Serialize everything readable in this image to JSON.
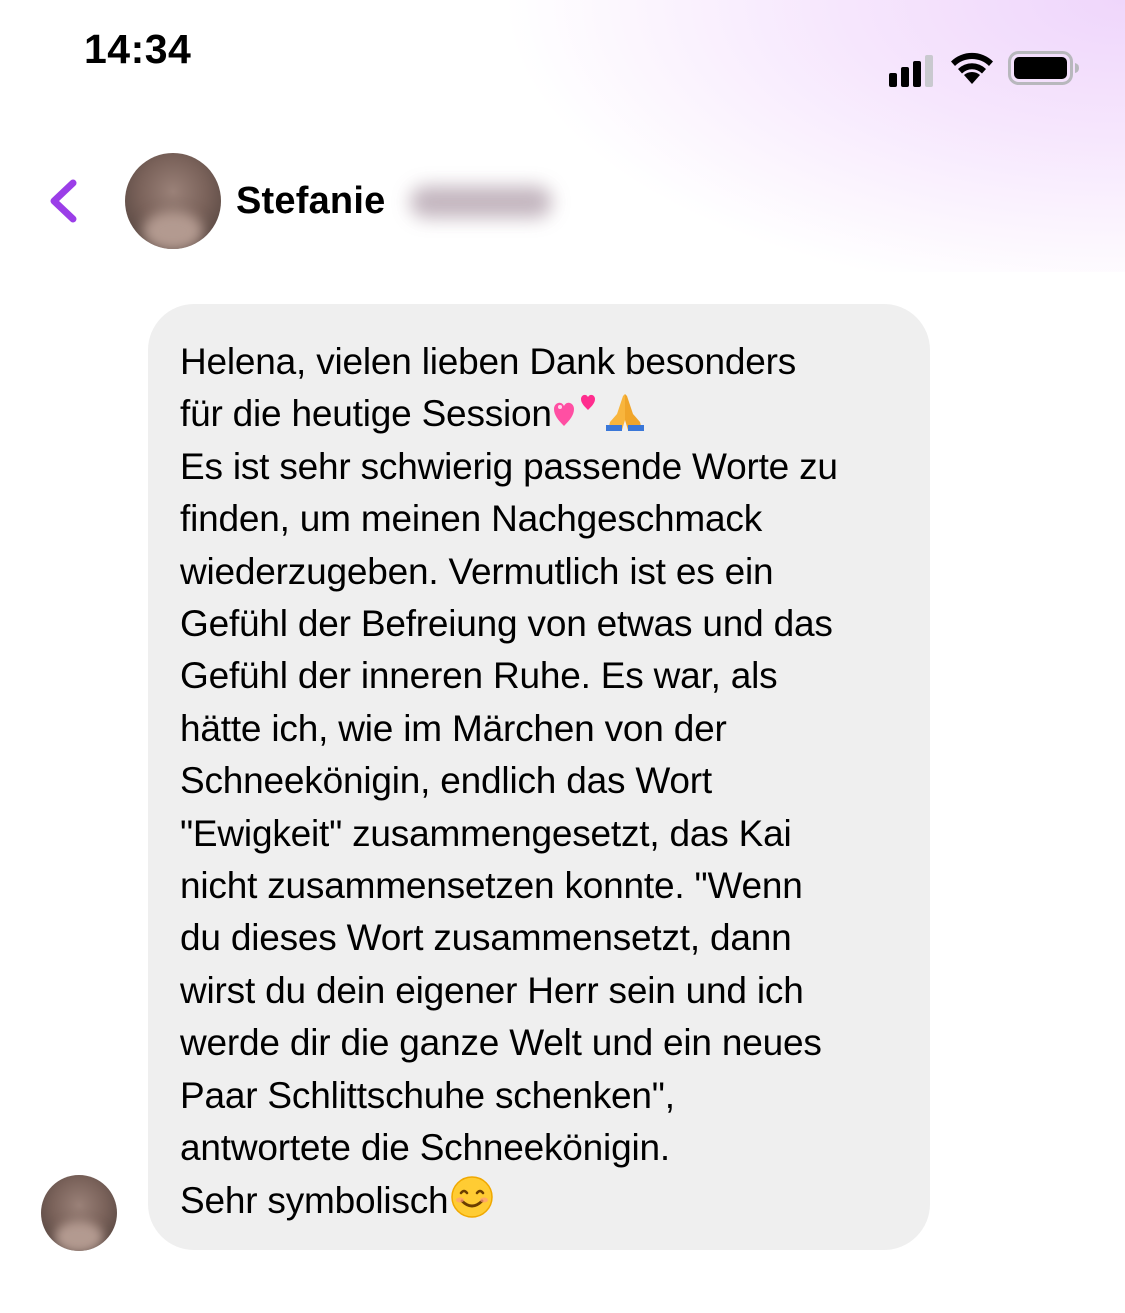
{
  "status_bar": {
    "time": "14:34",
    "icons": [
      "cellular-signal-icon",
      "wifi-icon",
      "battery-icon"
    ]
  },
  "header": {
    "back_icon": "chevron-left-icon",
    "contact_first_name": "Stefanie",
    "contact_last_name_blurred": true,
    "accent_color": "#9b3ee8"
  },
  "message": {
    "lines": [
      "Helena, vielen lieben Dank besonders",
      "für die heutige Session",
      "Es ist sehr schwierig passende Worte zu",
      "finden, um meinen Nachgeschmack",
      "wiederzugeben. Vermutlich ist es ein",
      "Gefühl der Befreiung von etwas und das",
      "Gefühl der inneren Ruhe. Es war, als",
      "hätte ich, wie im Märchen von der",
      "Schneekönigin, endlich das Wort",
      "\"Ewigkeit\" zusammengesetzt, das Kai",
      "nicht zusammensetzen konnte. \"Wenn",
      "du dieses Wort zusammensetzt, dann",
      "wirst du dein eigener Herr sein und ich",
      "werde dir die ganze Welt und ein neues",
      "Paar Schlittschuhe schenken\",",
      "antwortete die Schneekönigin.",
      "Sehr symbolisch"
    ],
    "emojis": {
      "line_2": [
        "two-hearts-icon",
        "folded-hands-icon"
      ],
      "line_17": [
        "smiling-face-icon"
      ]
    },
    "bubble_color": "#efefef"
  }
}
